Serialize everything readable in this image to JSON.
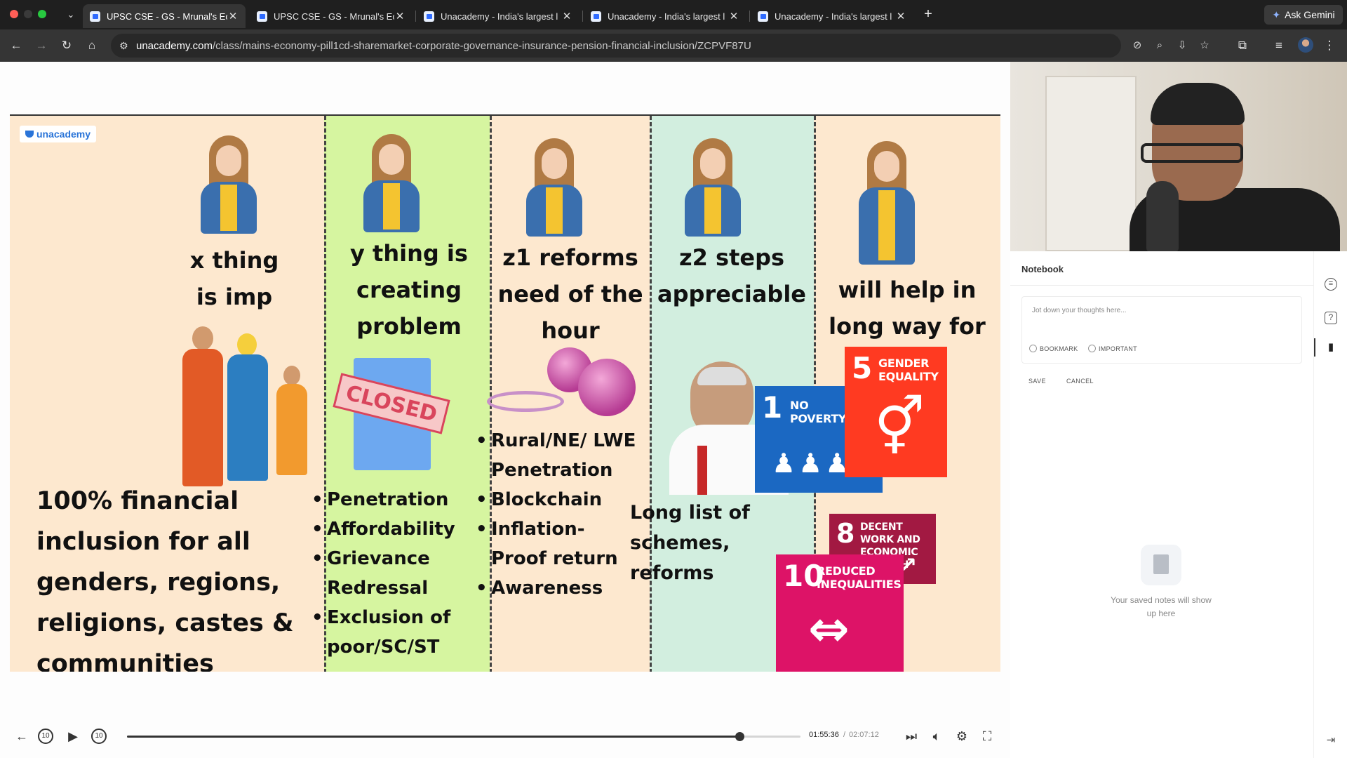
{
  "browser": {
    "tabs": [
      {
        "title": "UPSC CSE - GS - Mrunal's Ec",
        "active": true
      },
      {
        "title": "UPSC CSE - GS - Mrunal's Ec",
        "active": false
      },
      {
        "title": "Unacademy - India's largest l",
        "active": false
      },
      {
        "title": "Unacademy - India's largest l",
        "active": false
      },
      {
        "title": "Unacademy - India's largest l",
        "active": false
      }
    ],
    "ask_gemini": "Ask Gemini",
    "url_host": "unacademy.com",
    "url_path": "/class/mains-economy-pill1cd-sharemarket-corporate-governance-insurance-pension-financial-inclusion/ZCPVF87U"
  },
  "slide": {
    "logo": "unacademy",
    "columns": [
      {
        "heading": [
          "x thing",
          "is imp"
        ],
        "body": [
          "100% financial",
          "inclusion for all",
          "genders, regions,",
          "religions, castes &",
          "communities"
        ]
      },
      {
        "heading": [
          "y thing is",
          "creating",
          "problem"
        ],
        "sign": "CLOSED",
        "bullets": [
          "Penetration",
          "Affordability",
          "Grievance Redressal",
          "Exclusion of poor/SC/ST"
        ]
      },
      {
        "heading": [
          "z1 reforms",
          "need of the",
          "hour"
        ],
        "bullets": [
          "Rural/NE/ LWE Penetration",
          "Blockchain",
          "Inflation- Proof return",
          "Awareness"
        ]
      },
      {
        "heading": [
          "z2 steps",
          "appreciable"
        ],
        "body": [
          "Long list of",
          "schemes,",
          "reforms"
        ]
      },
      {
        "heading": [
          "will help in",
          "long way for"
        ]
      }
    ],
    "sdg_tiles": [
      {
        "num": "1",
        "label": [
          "NO",
          "POVERTY"
        ],
        "color": "#e5243b"
      },
      {
        "num": "5",
        "label": [
          "GENDER",
          "EQUALITY"
        ],
        "color": "#ff3a21"
      },
      {
        "num": "8",
        "label": [
          "DECENT WORK AND",
          "ECONOMIC GROWTH"
        ],
        "color": "#a21942"
      },
      {
        "num": "10",
        "label": [
          "REDUCED",
          "INEQUALITIES"
        ],
        "color": "#dd1367"
      }
    ]
  },
  "player": {
    "current_time": "01:55:36",
    "separator": "/",
    "total_time": "02:07:12",
    "progress": 0.909,
    "rewind_label": "10",
    "forward_label": "10"
  },
  "notebook": {
    "title": "Notebook",
    "placeholder": "Jot down your thoughts here...",
    "bookmark": "BOOKMARK",
    "important": "IMPORTANT",
    "save": "SAVE",
    "cancel": "CANCEL",
    "empty_text": "Your saved notes will show up here"
  }
}
